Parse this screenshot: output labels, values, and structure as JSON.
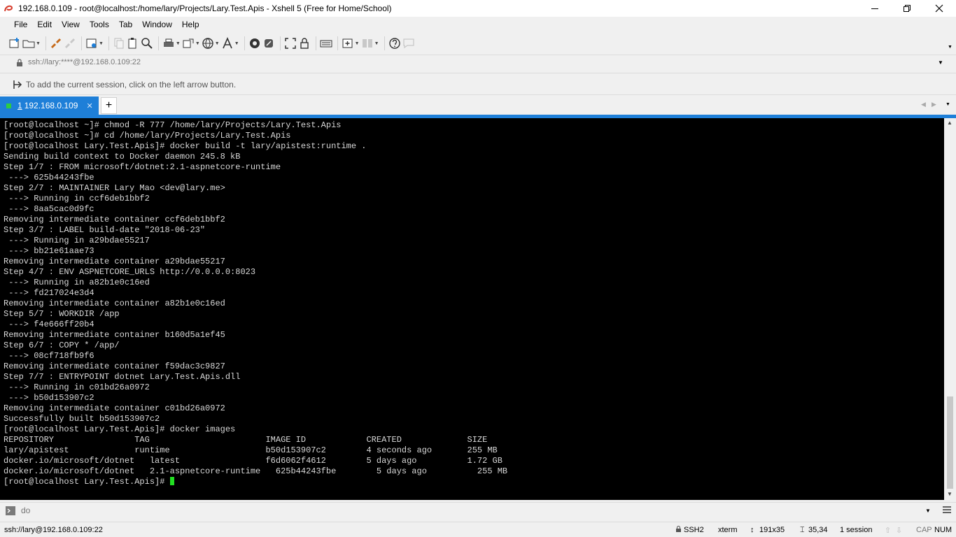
{
  "window": {
    "title": "192.168.0.109 - root@localhost:/home/lary/Projects/Lary.Test.Apis - Xshell 5 (Free for Home/School)"
  },
  "menu": [
    "File",
    "Edit",
    "View",
    "Tools",
    "Tab",
    "Window",
    "Help"
  ],
  "address": {
    "value": "ssh://lary:****@192.168.0.109:22"
  },
  "linkbar": {
    "hint": "To add the current session, click on the left arrow button."
  },
  "tabs": [
    {
      "number": "1",
      "label": "192.168.0.109"
    }
  ],
  "terminal": {
    "prompt_cursor": "[root@localhost Lary.Test.Apis]# ",
    "lines": [
      "[root@localhost ~]# chmod -R 777 /home/lary/Projects/Lary.Test.Apis",
      "[root@localhost ~]# cd /home/lary/Projects/Lary.Test.Apis",
      "[root@localhost Lary.Test.Apis]# docker build -t lary/apistest:runtime .",
      "Sending build context to Docker daemon 245.8 kB",
      "Step 1/7 : FROM microsoft/dotnet:2.1-aspnetcore-runtime",
      " ---> 625b44243fbe",
      "Step 2/7 : MAINTAINER Lary Mao <dev@lary.me>",
      " ---> Running in ccf6deb1bbf2",
      " ---> 8aa5cac0d9fc",
      "Removing intermediate container ccf6deb1bbf2",
      "Step 3/7 : LABEL build-date \"2018-06-23\"",
      " ---> Running in a29bdae55217",
      " ---> bb21e61aae73",
      "Removing intermediate container a29bdae55217",
      "Step 4/7 : ENV ASPNETCORE_URLS http://0.0.0.0:8023",
      " ---> Running in a82b1e0c16ed",
      " ---> fd217024e3d4",
      "Removing intermediate container a82b1e0c16ed",
      "Step 5/7 : WORKDIR /app",
      " ---> f4e666ff20b4",
      "Removing intermediate container b160d5a1ef45",
      "Step 6/7 : COPY * /app/",
      " ---> 08cf718fb9f6",
      "Removing intermediate container f59dac3c9827",
      "Step 7/7 : ENTRYPOINT dotnet Lary.Test.Apis.dll",
      " ---> Running in c01bd26a0972",
      " ---> b50d153907c2",
      "Removing intermediate container c01bd26a0972",
      "Successfully built b50d153907c2",
      "[root@localhost Lary.Test.Apis]# docker images",
      "REPOSITORY                TAG                       IMAGE ID            CREATED             SIZE",
      "lary/apistest             runtime                   b50d153907c2        4 seconds ago       255 MB",
      "docker.io/microsoft/dotnet   latest                 f6d6062f4612        5 days ago          1.72 GB",
      "docker.io/microsoft/dotnet   2.1-aspnetcore-runtime   625b44243fbe        5 days ago          255 MB"
    ]
  },
  "command_bar": {
    "placeholder": "do"
  },
  "status": {
    "connection": "ssh://lary@192.168.0.109:22",
    "protocol": "SSH2",
    "terminal_type": "xterm",
    "size": "191x35",
    "cursor_pos": "35,34",
    "sessions": "1 session",
    "cap": "CAP",
    "num": "NUM"
  },
  "colors": {
    "accent": "#1e7fd8",
    "terminal_bg": "#000000",
    "terminal_fg": "#d8d8d8",
    "cursor": "#22e022"
  }
}
